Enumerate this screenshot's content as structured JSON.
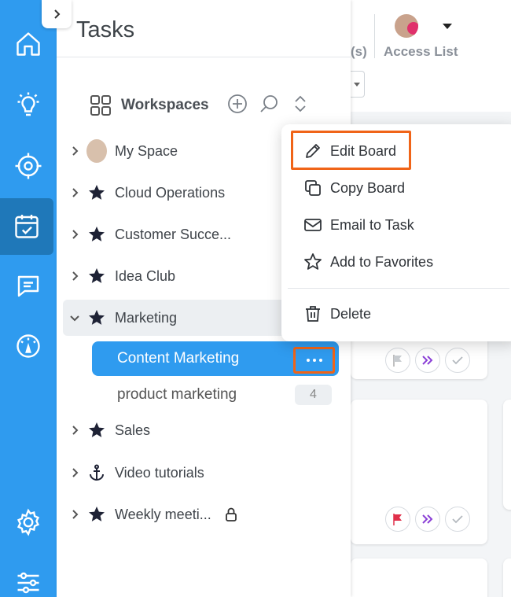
{
  "panel": {
    "title": "Tasks"
  },
  "header": {
    "access_partial": "(s)",
    "access_label": "Access List"
  },
  "workspaces": {
    "label": "Workspaces"
  },
  "tree": [
    {
      "label": "My Space",
      "icon": "user-avatar"
    },
    {
      "label": "Cloud Operations",
      "icon": "star-icon"
    },
    {
      "label": "Customer Succe...",
      "icon": "star-icon"
    },
    {
      "label": "Idea Club",
      "icon": "star-icon"
    },
    {
      "label": "Marketing",
      "icon": "star-icon",
      "expanded": true
    },
    {
      "label": "Sales",
      "icon": "star-icon"
    },
    {
      "label": "Video tutorials",
      "icon": "anchor-icon"
    },
    {
      "label": "Weekly meeti...",
      "icon": "star-icon",
      "locked": true
    }
  ],
  "boards": [
    {
      "label": "Content Marketing",
      "active": true
    },
    {
      "label": "product marketing",
      "count": "4"
    }
  ],
  "menu": {
    "items": [
      {
        "label": "Edit Board",
        "icon": "pencil-icon"
      },
      {
        "label": "Copy Board",
        "icon": "copy-icon"
      },
      {
        "label": "Email to Task",
        "icon": "mail-icon"
      },
      {
        "label": "Add to Favorites",
        "icon": "star-outline-icon"
      },
      {
        "label": "Delete",
        "icon": "trash-icon"
      }
    ]
  },
  "colors": {
    "rail": "#2f9bef",
    "rail_active": "#1f78b9",
    "highlight": "#f06418",
    "flag_red": "#e0304a",
    "purple": "#8a3fd6"
  }
}
